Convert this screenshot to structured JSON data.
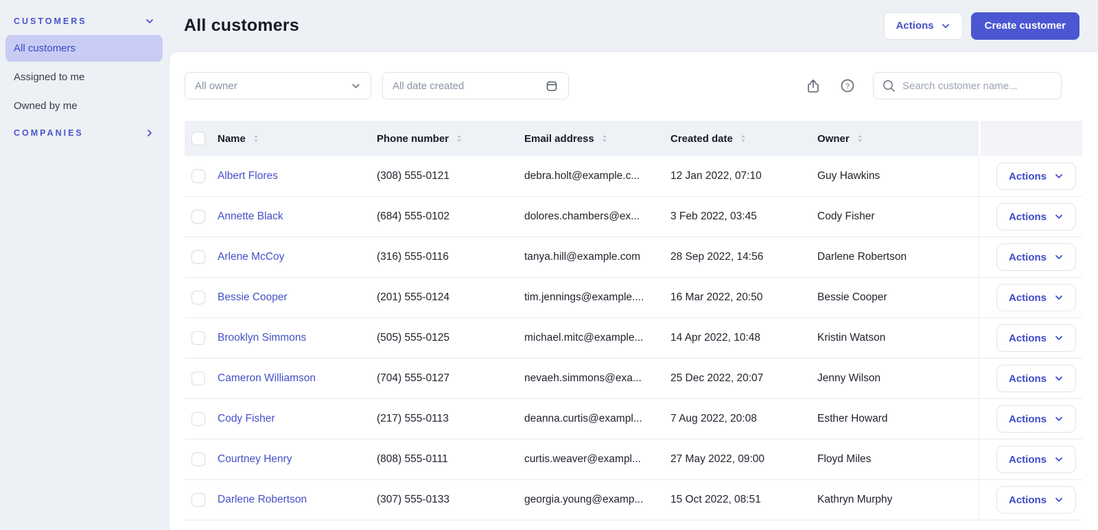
{
  "colors": {
    "page_background": "#edf0f4",
    "accent_indigo": "#4b57d2",
    "link_indigo": "#4450c8",
    "selected_item_background": "#c8ccf4"
  },
  "sidebar": {
    "customers_section": {
      "label": "CUSTOMERS",
      "state": "expanded"
    },
    "items": [
      {
        "label": "All customers",
        "selected": true
      },
      {
        "label": "Assigned to me",
        "selected": false
      },
      {
        "label": "Owned by me",
        "selected": false
      }
    ],
    "companies_section": {
      "label": "COMPANIES",
      "state": "collapsed"
    }
  },
  "header": {
    "title": "All customers",
    "actions_button": "Actions",
    "create_button": "Create customer"
  },
  "filters": {
    "owner_placeholder": "All owner",
    "date_created_placeholder": "All date created",
    "search_placeholder": "Search customer name..."
  },
  "table": {
    "columns": [
      "Name",
      "Phone number",
      "Email address",
      "Created date",
      "Owner"
    ],
    "row_action_label": "Actions",
    "rows": [
      {
        "name": "Albert Flores",
        "phone": "(308) 555-0121",
        "email": "debra.holt@example.c...",
        "created": "12 Jan 2022, 07:10",
        "owner": "Guy Hawkins"
      },
      {
        "name": "Annette Black",
        "phone": "(684) 555-0102",
        "email": "dolores.chambers@ex...",
        "created": "3 Feb 2022, 03:45",
        "owner": "Cody Fisher"
      },
      {
        "name": "Arlene McCoy",
        "phone": "(316) 555-0116",
        "email": "tanya.hill@example.com",
        "created": "28 Sep 2022, 14:56",
        "owner": "Darlene Robertson"
      },
      {
        "name": "Bessie Cooper",
        "phone": "(201) 555-0124",
        "email": "tim.jennings@example....",
        "created": "16 Mar 2022, 20:50",
        "owner": "Bessie Cooper"
      },
      {
        "name": "Brooklyn Simmons",
        "phone": "(505) 555-0125",
        "email": "michael.mitc@example...",
        "created": "14 Apr 2022, 10:48",
        "owner": "Kristin Watson"
      },
      {
        "name": "Cameron Williamson",
        "phone": "(704) 555-0127",
        "email": "nevaeh.simmons@exa...",
        "created": "25 Dec 2022, 20:07",
        "owner": "Jenny Wilson"
      },
      {
        "name": "Cody Fisher",
        "phone": "(217) 555-0113",
        "email": "deanna.curtis@exampl...",
        "created": "7 Aug 2022, 20:08",
        "owner": "Esther Howard"
      },
      {
        "name": "Courtney Henry",
        "phone": "(808) 555-0111",
        "email": "curtis.weaver@exampl...",
        "created": "27 May 2022, 09:00",
        "owner": "Floyd Miles"
      },
      {
        "name": "Darlene Robertson",
        "phone": "(307) 555-0133",
        "email": "georgia.young@examp...",
        "created": "15 Oct 2022, 08:51",
        "owner": "Kathryn Murphy"
      }
    ]
  }
}
